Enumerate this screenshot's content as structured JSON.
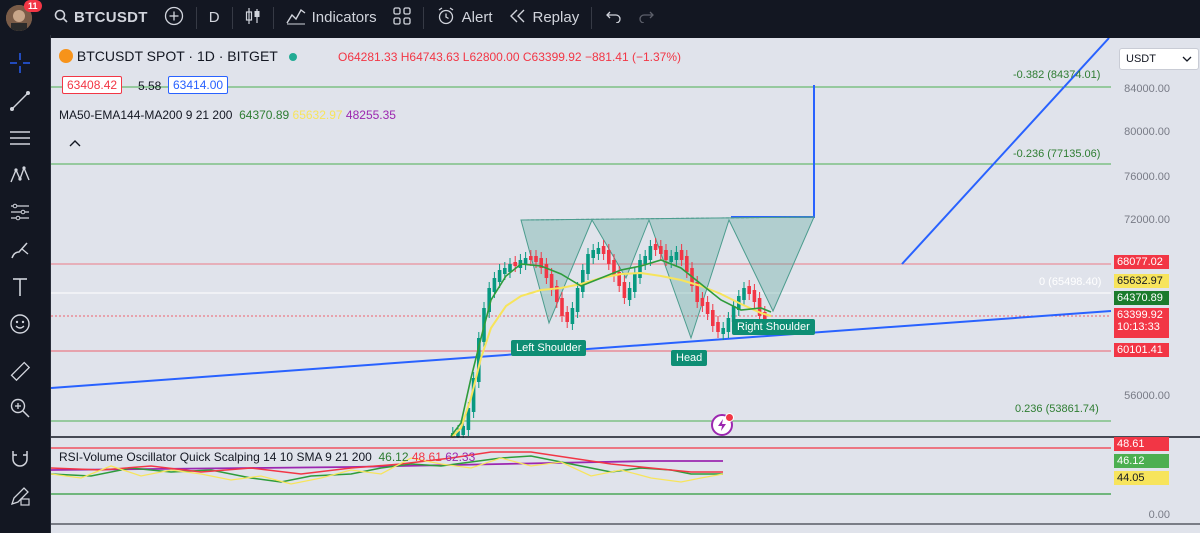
{
  "topbar": {
    "notification_count": "11",
    "symbol": "BTCUSDT",
    "interval": "D",
    "indicators_label": "Indicators",
    "alert_label": "Alert",
    "replay_label": "Replay"
  },
  "legend": {
    "title": "BTCUSDT SPOT · 1D · BITGET",
    "open": "O64281.33",
    "high": "H64743.63",
    "low": "L62800.00",
    "close": "C63399.92",
    "change": "−881.41 (−1.37%)",
    "bid": "63408.42",
    "spread": "5.58",
    "ask": "63414.00",
    "ma_name": "MA50-EMA144-MA200 9 21 200",
    "ma_v1": "64370.89",
    "ma_v2": "65632.97",
    "ma_v3": "48255.35",
    "rsi_name": "RSI-Volume Oscillator Quick Scalping 14 10 SMA 9 21 200",
    "rsi_v1": "46.12",
    "rsi_v2": "48.61",
    "rsi_v3": "62.33"
  },
  "currency": "USDT",
  "price_axis": [
    "84000.00",
    "80000.00",
    "76000.00",
    "72000.00",
    "56000.00"
  ],
  "price_tags": {
    "p1": "68077.02",
    "p2": "65632.97",
    "p3": "64370.89",
    "p4": "63399.92",
    "timer": "10:13:33",
    "p5": "60101.41"
  },
  "rsi_axis": {
    "r1": "48.61",
    "r2": "46.12",
    "r3": "44.05",
    "r0": "0.00"
  },
  "fib": {
    "f1": "-0.382 (84374.01)",
    "f2": "-0.236 (77135.06)",
    "f3": "0 (65498.40)",
    "f4": "0.236 (53861.74)"
  },
  "patterns": {
    "left": "Left Shoulder",
    "head": "Head",
    "right": "Right Shoulder"
  },
  "colors": {
    "up": "#089981",
    "down": "#f23645",
    "trend": "#2962ff",
    "fib": "#4caf50"
  }
}
